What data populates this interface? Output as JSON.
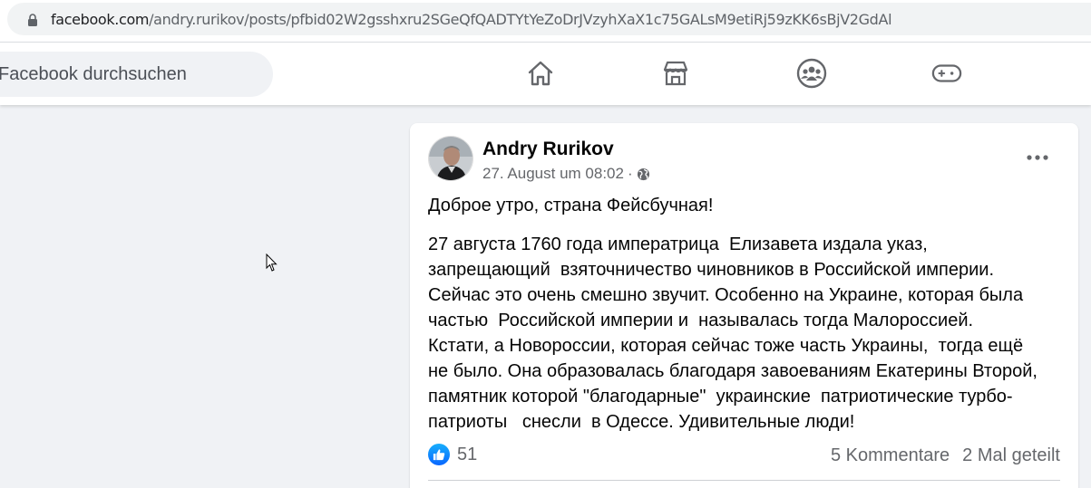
{
  "browser": {
    "url_host": "facebook.com",
    "url_path": "/andry.rurikov/posts/pfbid02W2gsshxru2SGeQfQADTYtYeZoDrJVzyhXaX1c75GALsM9etiRj59zKK6sBjV2GdAl"
  },
  "header": {
    "search_placeholder": "Facebook durchsuchen",
    "nav_icons": [
      "home-icon",
      "marketplace-icon",
      "groups-icon",
      "gaming-icon"
    ]
  },
  "post": {
    "author": "Andry Rurikov",
    "date": "27. August um 08:02",
    "separator": "·",
    "privacy_icon": "globe-icon",
    "greeting": "Доброе утро, страна Фейсбучная!",
    "body_lines": [
      "27 августа 1760 года императрица  Елизавета издала указ,",
      "запрещающий  взяточничество чиновников в Российской империи.",
      "Сейчас это очень смешно звучит. Особенно на Украине, которая была",
      "частью  Российской империи и  называлась тогда Малороссией.",
      "Кстати, а Новороссии, которая сейчас тоже часть Украины,  тогда ещё",
      "не было. Она образовалась благодаря завоеваниям Екатерины Второй,",
      "памятник которой \"благодарные\"  украинские  патриотические турбо-",
      "патриоты   снесли  в Одессе. Удивительные люди!"
    ],
    "likes": "51",
    "comments": "5 Kommentare",
    "shares": "2 Mal geteilt"
  },
  "colors": {
    "page_bg": "#f0f2f5",
    "card_bg": "#ffffff",
    "text": "#050505",
    "muted": "#65676b",
    "like_blue": "#0966ff"
  }
}
